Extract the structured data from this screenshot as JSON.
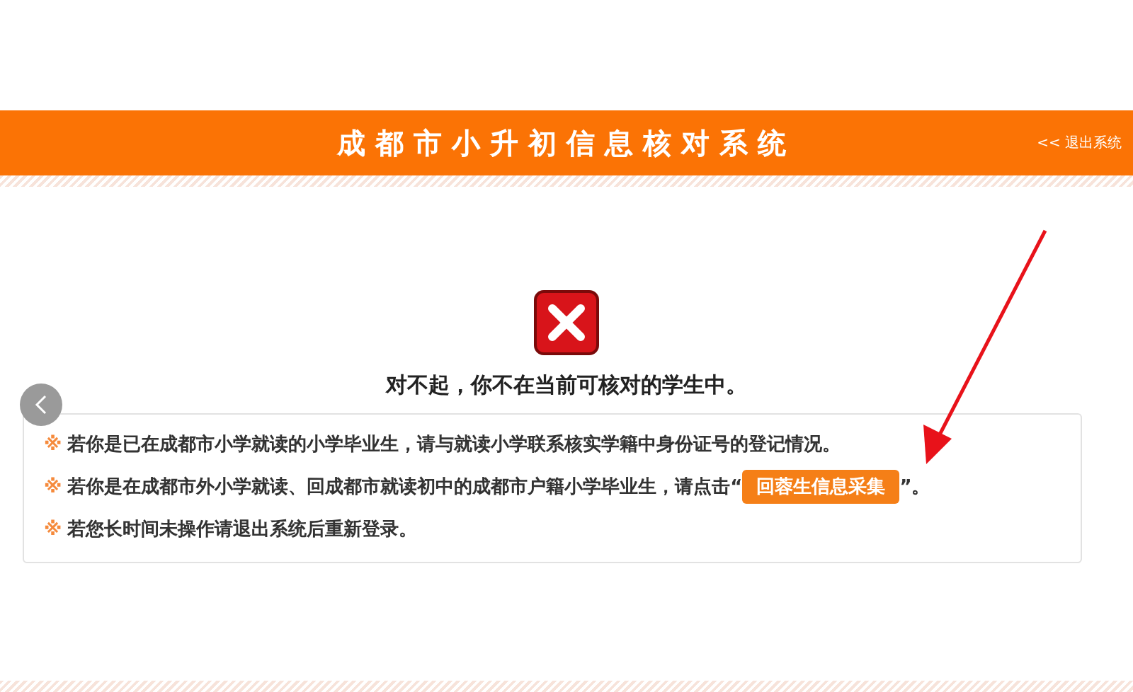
{
  "header": {
    "title": "成都市小升初信息核对系统",
    "logout": "<< 退出系统"
  },
  "result": {
    "kind": "error",
    "message": "对不起，你不在当前可核对的学生中。"
  },
  "notes": [
    {
      "marker": "※",
      "text": "若你是已在成都市小学就读的小学毕业生，请与就读小学联系核实学籍中身份证号的登记情况。"
    },
    {
      "marker": "※",
      "text": "若你是在成都市外小学就读、回成都市就读初中的成都市户籍小学毕业生，请点击“",
      "button": "回蓉生信息采集",
      "text_after": "”。"
    },
    {
      "marker": "※",
      "text": "若您长时间未操作请退出系统后重新登录。"
    }
  ]
}
